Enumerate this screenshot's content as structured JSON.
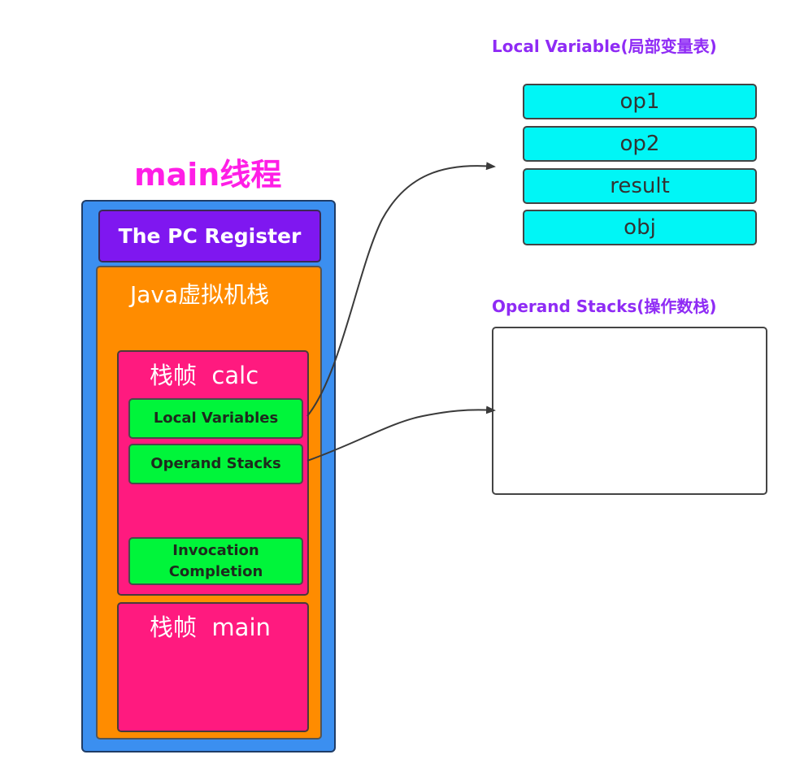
{
  "thread": {
    "title": "main线程"
  },
  "pc_register": {
    "label": "The PC Register"
  },
  "jvm_stack": {
    "label": "Java虚拟机栈"
  },
  "frames": {
    "calc": {
      "label": "栈帧  calc",
      "local_variables": "Local Variables",
      "operand_stacks": "Operand Stacks",
      "invocation_line1": "Invocation",
      "invocation_line2": "Completion"
    },
    "main": {
      "label": "栈帧  main"
    }
  },
  "local_variable_table": {
    "title": "Local Variable(局部变量表)",
    "entries": [
      "op1",
      "op2",
      "result",
      "obj"
    ]
  },
  "operand_stack": {
    "title": "Operand Stacks(操作数栈)"
  },
  "colors": {
    "thread": "#3b8ff0",
    "pc_register": "#7f17f0",
    "jvm_stack": "#ff8c00",
    "frame": "#ff1a7f",
    "slot": "#00f53a",
    "local_variable_cell": "#00f6f6",
    "title_magenta": "#ff1ee6",
    "title_purple": "#8f2bf5"
  }
}
